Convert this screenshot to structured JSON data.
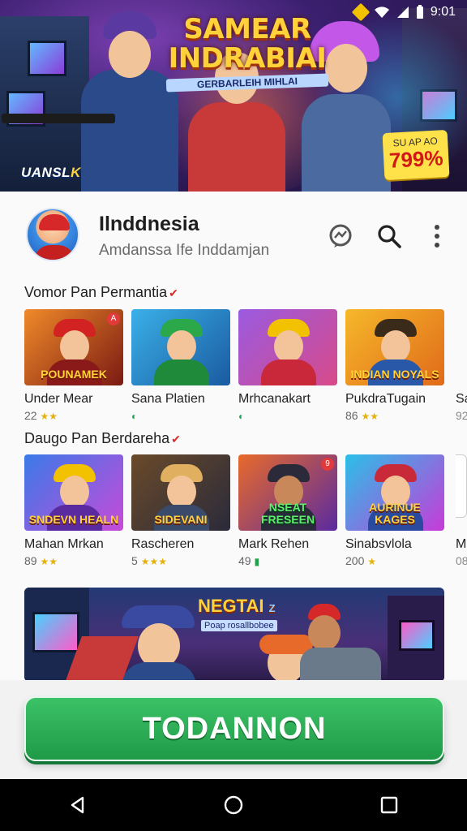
{
  "status_bar": {
    "time": "9:01"
  },
  "hero": {
    "title_line1": "SAMEAR",
    "title_line2": "INDRABIAI",
    "subtitle": "GERBARLEIH MIHLAI",
    "logo_left": "UANSL",
    "logo_right": "K",
    "badge_small": "SU AP AO",
    "badge_big": "799%",
    "colors": {
      "title": "#ffd23a",
      "badge": "#ffe24a"
    }
  },
  "app": {
    "title": "Ilnddnesia",
    "subtitle": "Amdanssa Ife Inddamjan",
    "icons": [
      "chat-icon",
      "search-icon",
      "more-vert-icon"
    ]
  },
  "sections": [
    {
      "title": "Vomor Pan Permantia",
      "items": [
        {
          "name": "Under Mear",
          "rating": "22",
          "caption": "POUNAMEK"
        },
        {
          "name": "Sana Platien",
          "rating": "",
          "caption": ""
        },
        {
          "name": "Mrhcanakart",
          "rating": "",
          "caption": ""
        },
        {
          "name": "PukdraTugain",
          "rating": "86",
          "caption": "INDIAN NOYALS"
        }
      ],
      "peek": {
        "name": "Sa",
        "meta": "92"
      }
    },
    {
      "title": "Daugo Pan Berdareha",
      "items": [
        {
          "name": "Mahan Mrkan",
          "rating": "89",
          "caption": "SNDEVN HEALN"
        },
        {
          "name": "Rascheren",
          "rating": "5",
          "caption": "SIDEVANI"
        },
        {
          "name": "Mark Rehen",
          "rating": "49",
          "caption": "NSEAT FRESEEN"
        },
        {
          "name": "Sinabsvlola",
          "rating": "200",
          "caption": "AURINUE KAGES"
        }
      ],
      "peek": {
        "name": "Mi",
        "meta": "08"
      }
    }
  ],
  "promo": {
    "title": "NEGTAI",
    "title_mark": "Z",
    "subtitle": "Poap rosallbobee"
  },
  "cta": {
    "label": "TODANNON",
    "color": "#27a851"
  },
  "nav": {
    "back": "back-icon",
    "home": "home-icon",
    "recents": "recents-icon"
  }
}
